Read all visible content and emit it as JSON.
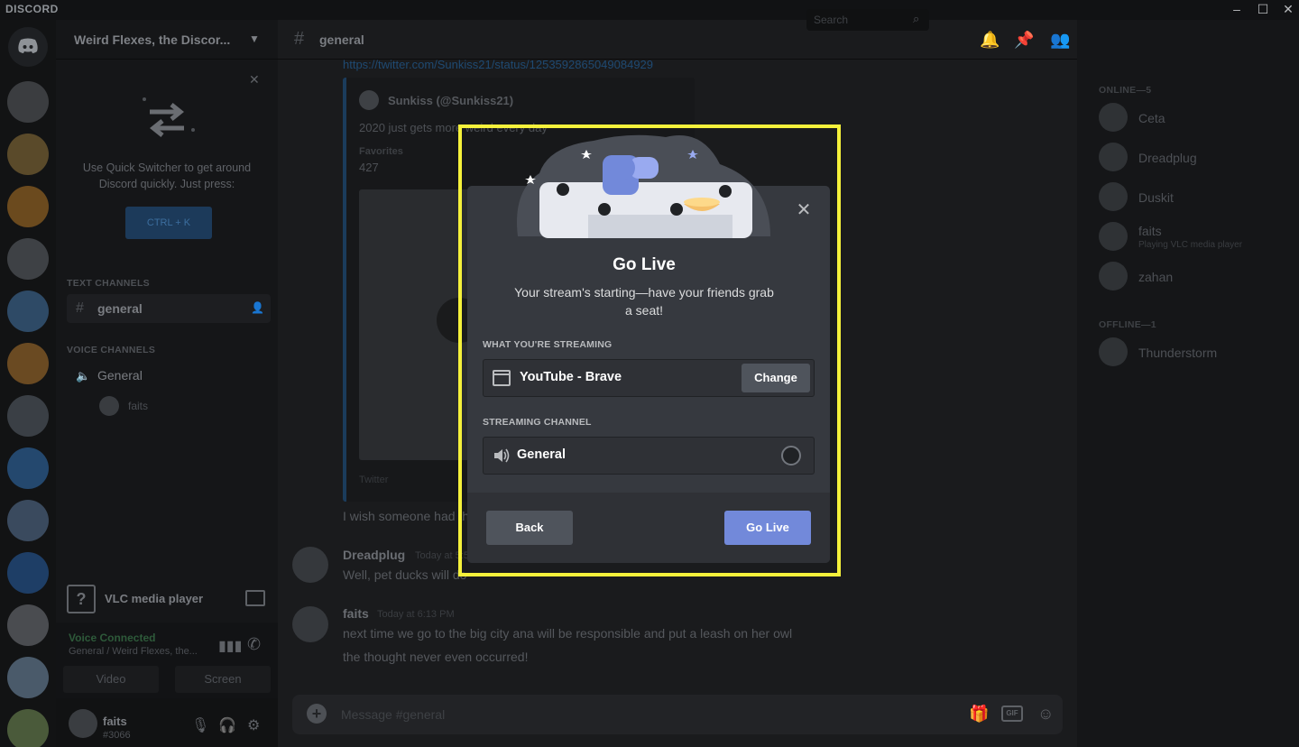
{
  "window": {
    "title": "DISCORD",
    "controls": [
      "–",
      "☐",
      "✕"
    ]
  },
  "servers": [
    {
      "color": "#3b3d40"
    },
    {
      "color": "#5a4a2a"
    },
    {
      "color": "#6b4a1e"
    },
    {
      "color": "#3e4145"
    },
    {
      "color": "#2e4a66"
    },
    {
      "color": "#6a4a22"
    },
    {
      "color": "#3a3f45"
    },
    {
      "color": "#24486e"
    },
    {
      "color": "#3a4a5e"
    },
    {
      "color": "#1e3e66"
    },
    {
      "color": "#4a4c50"
    },
    {
      "color": "#4a5a6a"
    },
    {
      "color": "#4a5a3a"
    }
  ],
  "sidebar": {
    "guild_name": "Weird Flexes, the Discor...",
    "quick_switcher": {
      "text": "Use Quick Switcher to get around Discord quickly. Just press:",
      "shortcut": "CTRL + K"
    },
    "text_category": "TEXT CHANNELS",
    "text_channel": "general",
    "voice_category": "VOICE CHANNELS",
    "voice_channel": "General",
    "voice_user": "faits",
    "activity": "VLC media player",
    "voice_status": "Voice Connected",
    "voice_sub": "General / Weird Flexes, the...",
    "video_label": "Video",
    "screen_label": "Screen",
    "user": {
      "name": "faits",
      "tag": "#3066"
    }
  },
  "chat": {
    "channel": "general",
    "search_placeholder": "Search",
    "link": "https://twitter.com/Sunkiss21/status/1253592865049084929",
    "embed": {
      "author": "Sunkiss (@Sunkiss21)",
      "text": "2020 just gets more weird every day",
      "fav_label": "Favorites",
      "fav_value": "427",
      "footer": "Twitter"
    },
    "line1": "I wish someone had the guts to make a duck that was big enough to stand on its own",
    "messages": [
      {
        "author": "Dreadplug",
        "time": "Today at 5:58 PM",
        "lines": [
          "Well, pet ducks will do"
        ]
      },
      {
        "author": "faits",
        "time": "Today at 6:13 PM",
        "lines": [
          "next time we go to the big city ana will be responsible and put a leash on her owl",
          "the thought never even occurred!"
        ]
      }
    ],
    "composer_placeholder": "Message #general",
    "gif_label": "GIF"
  },
  "members": {
    "online_label": "ONLINE—5",
    "online": [
      {
        "name": "Ceta",
        "activity": ""
      },
      {
        "name": "Dreadplug",
        "activity": ""
      },
      {
        "name": "Duskit",
        "activity": ""
      },
      {
        "name": "faits",
        "activity": "Playing VLC media player"
      },
      {
        "name": "zahan",
        "activity": ""
      }
    ],
    "offline_label": "OFFLINE—1",
    "offline": [
      {
        "name": "Thunderstorm",
        "activity": ""
      }
    ]
  },
  "modal": {
    "title": "Go Live",
    "subtitle": "Your stream's starting—have your friends grab a seat!",
    "streaming_label": "WHAT YOU'RE STREAMING",
    "streaming_value": "YouTube - Brave",
    "change_label": "Change",
    "channel_label": "STREAMING CHANNEL",
    "channel_value": "General",
    "back_label": "Back",
    "golive_label": "Go Live",
    "highlight_color": "#f5f13b",
    "accent_color": "#7289da"
  }
}
